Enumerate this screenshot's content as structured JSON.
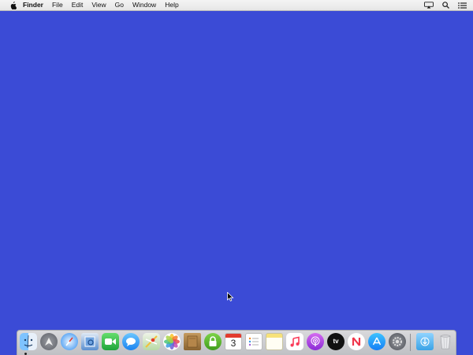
{
  "menubar": {
    "app_name": "Finder",
    "menus": [
      "File",
      "Edit",
      "View",
      "Go",
      "Window",
      "Help"
    ],
    "status_icons": [
      "airplay-display-icon",
      "spotlight-search-icon",
      "notification-center-icon"
    ]
  },
  "dock": {
    "apps": [
      {
        "name": "Finder",
        "icon": "finder-icon",
        "running": true
      },
      {
        "name": "Launchpad",
        "icon": "launchpad-icon"
      },
      {
        "name": "Safari",
        "icon": "safari-icon"
      },
      {
        "name": "Preview",
        "icon": "preview-icon"
      },
      {
        "name": "FaceTime",
        "icon": "facetime-icon"
      },
      {
        "name": "Messages",
        "icon": "messages-icon"
      },
      {
        "name": "Maps",
        "icon": "maps-icon"
      },
      {
        "name": "Photos",
        "icon": "photos-icon"
      },
      {
        "name": "Notefile",
        "icon": "notebook-icon"
      },
      {
        "name": "Keychain",
        "icon": "lock-icon"
      },
      {
        "name": "Calendar",
        "icon": "calendar-icon",
        "day": "3"
      },
      {
        "name": "Reminders",
        "icon": "reminders-icon"
      },
      {
        "name": "Notes",
        "icon": "notes-icon"
      },
      {
        "name": "Music",
        "icon": "music-icon"
      },
      {
        "name": "Podcasts",
        "icon": "podcasts-icon"
      },
      {
        "name": "TV",
        "icon": "tv-icon",
        "label": "tv"
      },
      {
        "name": "News",
        "icon": "news-icon"
      },
      {
        "name": "App Store",
        "icon": "app-store-icon"
      },
      {
        "name": "System Preferences",
        "icon": "system-preferences-icon"
      }
    ],
    "stacks": [
      {
        "name": "Downloads",
        "icon": "downloads-folder-icon"
      },
      {
        "name": "Trash",
        "icon": "trash-icon"
      }
    ]
  },
  "colors": {
    "desktop": "#3b4bd6",
    "menubar": "#ececec",
    "dock": "#cdced2"
  }
}
